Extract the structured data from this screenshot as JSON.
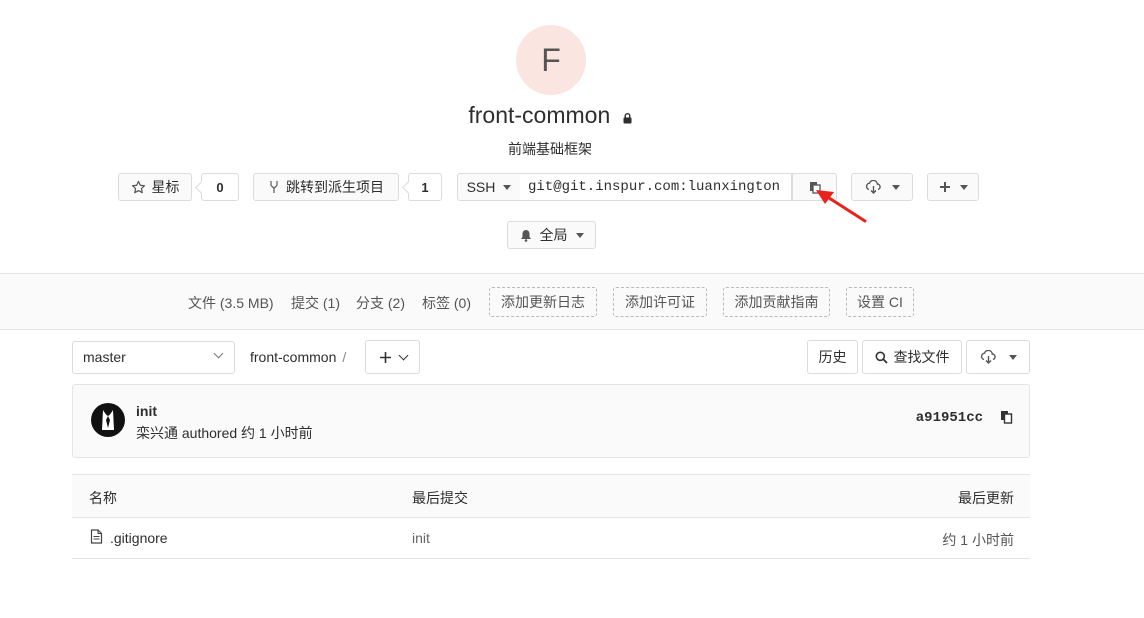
{
  "project": {
    "avatar_letter": "F",
    "name": "front-common",
    "description": "前端基础框架"
  },
  "actions": {
    "star_label": "星标",
    "star_count": "0",
    "fork_label": "跳转到派生项目",
    "fork_count": "1",
    "clone_protocol": "SSH",
    "clone_url": "git@git.inspur.com:luanxington",
    "notification_label": "全局"
  },
  "nav": {
    "files": "文件 (3.5 MB)",
    "commits": "提交 (1)",
    "branches": "分支 (2)",
    "tags": "标签 (0)",
    "add_changelog": "添加更新日志",
    "add_license": "添加许可证",
    "add_contributing": "添加贡献指南",
    "setup_ci": "设置 CI"
  },
  "repo": {
    "branch": "master",
    "breadcrumb": "front-common",
    "breadcrumb_sep": "/",
    "history_label": "历史",
    "find_file_label": "查找文件"
  },
  "last_commit": {
    "title": "init",
    "meta": "栾兴通 authored 约 1 小时前",
    "sha": "a91951cc"
  },
  "files_table": {
    "headers": {
      "name": "名称",
      "last_commit": "最后提交",
      "last_update": "最后更新"
    },
    "rows": [
      {
        "name": ".gitignore",
        "last_commit": "init",
        "last_update": "约 1 小时前"
      }
    ]
  },
  "colors": {
    "avatar_bg": "#fbe5e1",
    "arrow": "#e8231c"
  },
  "icons": [
    "lock-icon",
    "star-icon",
    "fork-icon",
    "clipboard-icon",
    "download-icon",
    "plus-icon",
    "bell-icon",
    "search-icon",
    "file-icon"
  ]
}
